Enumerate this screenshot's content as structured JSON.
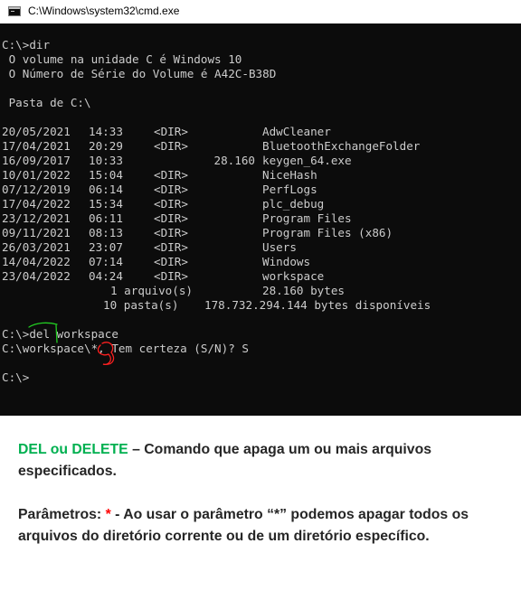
{
  "window": {
    "title": "C:\\Windows\\system32\\cmd.exe"
  },
  "console": {
    "cmd_dir": "C:\\>dir",
    "volume_line": " O volume na unidade C é Windows 10",
    "serial_line": " O Número de Série do Volume é A42C-B38D",
    "folder_line": " Pasta de C:\\",
    "entries": [
      {
        "date": "20/05/2021",
        "time": "14:33",
        "type": "<DIR>",
        "size": "",
        "name": "AdwCleaner"
      },
      {
        "date": "17/04/2021",
        "time": "20:29",
        "type": "<DIR>",
        "size": "",
        "name": "BluetoothExchangeFolder"
      },
      {
        "date": "16/09/2017",
        "time": "10:33",
        "type": "",
        "size": "28.160",
        "name": "keygen_64.exe"
      },
      {
        "date": "10/01/2022",
        "time": "15:04",
        "type": "<DIR>",
        "size": "",
        "name": "NiceHash"
      },
      {
        "date": "07/12/2019",
        "time": "06:14",
        "type": "<DIR>",
        "size": "",
        "name": "PerfLogs"
      },
      {
        "date": "17/04/2022",
        "time": "15:34",
        "type": "<DIR>",
        "size": "",
        "name": "plc_debug"
      },
      {
        "date": "23/12/2021",
        "time": "06:11",
        "type": "<DIR>",
        "size": "",
        "name": "Program Files"
      },
      {
        "date": "09/11/2021",
        "time": "08:13",
        "type": "<DIR>",
        "size": "",
        "name": "Program Files (x86)"
      },
      {
        "date": "26/03/2021",
        "time": "23:07",
        "type": "<DIR>",
        "size": "",
        "name": "Users"
      },
      {
        "date": "14/04/2022",
        "time": "07:14",
        "type": "<DIR>",
        "size": "",
        "name": "Windows"
      },
      {
        "date": "23/04/2022",
        "time": "04:24",
        "type": "<DIR>",
        "size": "",
        "name": "workspace"
      }
    ],
    "summary_files": {
      "count": "1 arquivo(s)",
      "bytes": "28.160 bytes"
    },
    "summary_dirs": {
      "count": "10 pasta(s)",
      "bytes": "178.732.294.144 bytes disponíveis"
    },
    "cmd_del": "C:\\>del workspace",
    "prompt_confirm": "C:\\workspace\\*, Tem certeza (S/N)? S",
    "prompt_final": "C:\\>"
  },
  "explanation": {
    "term": "DEL ou DELETE",
    "definition": " – Comando que apaga um ou mais arquivos especificados.",
    "params_label": "Parâmetros: ",
    "params_symbol": "*",
    "params_text": " - Ao usar o parâmetro “*” podemos apagar todos os arquivos do diretório corrente ou de um diretório específico."
  },
  "colors": {
    "term": "#00b050",
    "symbol": "#ff0000",
    "console_bg": "#0c0c0c",
    "console_text": "#cccccc"
  }
}
